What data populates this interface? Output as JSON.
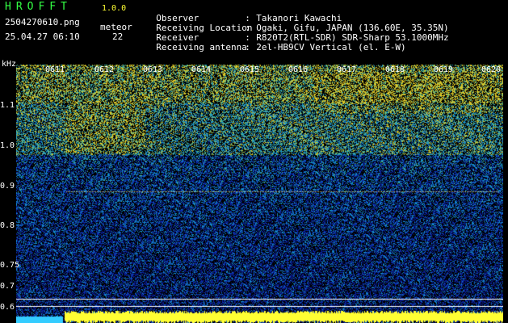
{
  "header": {
    "app_title": "HROFFT",
    "version": "1.0.0",
    "filename": "2504270610.png",
    "datetime": "25.04.27 06:10",
    "meteor_label": "meteor",
    "meteor_count": "22"
  },
  "info": [
    {
      "label": "Observer",
      "value": "Takanori Kawachi"
    },
    {
      "label": "Receiving Location",
      "value": "Ogaki, Gifu, JAPAN (136.60E, 35.35N)"
    },
    {
      "label": "Receiver",
      "value": "R820T2(RTL-SDR) SDR-Sharp 53.1000MHz"
    },
    {
      "label": "Receiving antenna",
      "value": "2el-HB9CV Vertical (el. E-W)"
    }
  ],
  "spectrogram": {
    "y_unit": "kHz",
    "y_ticks": [
      "1.1",
      "1.0",
      "0.9",
      "0.8",
      "0.75",
      "0.7",
      "0.6"
    ],
    "x_ticks": [
      "0611",
      "0612",
      "0613",
      "0614",
      "0615",
      "0616",
      "0617",
      "0618",
      "0619",
      "0620"
    ],
    "colors": {
      "background": "#000000",
      "noise_low": "#0a1a8c",
      "noise_high": "#1f6fd6",
      "signal": "#ffff33",
      "marker": "#ffffff"
    }
  }
}
